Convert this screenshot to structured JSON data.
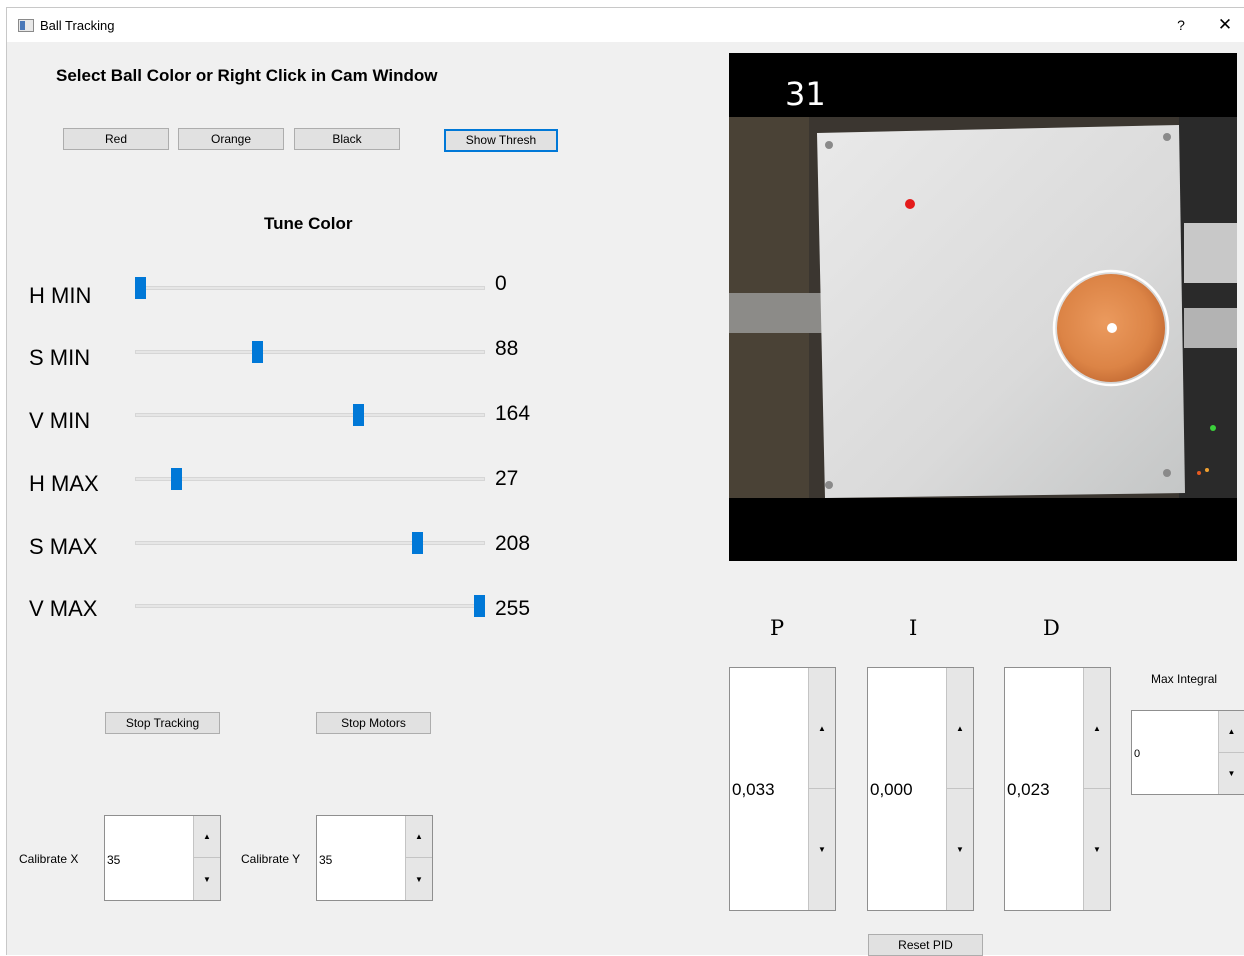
{
  "window": {
    "title": "Ball Tracking",
    "help_label": "?",
    "close_label": "✕"
  },
  "select": {
    "heading": "Select Ball Color or Right Click in Cam Window",
    "buttons": [
      {
        "label": "Red"
      },
      {
        "label": "Orange"
      },
      {
        "label": "Black"
      }
    ],
    "show_thresh_label": "Show Thresh"
  },
  "tune": {
    "heading": "Tune Color",
    "sliders": [
      {
        "label": "H MIN",
        "value": "0",
        "fraction": 0.0
      },
      {
        "label": "S MIN",
        "value": "88",
        "fraction": 0.345
      },
      {
        "label": "V MIN",
        "value": "164",
        "fraction": 0.643
      },
      {
        "label": "H MAX",
        "value": "27",
        "fraction": 0.106
      },
      {
        "label": "S MAX",
        "value": "208",
        "fraction": 0.816
      },
      {
        "label": "V MAX",
        "value": "255",
        "fraction": 1.0
      }
    ]
  },
  "controls": {
    "stop_tracking_label": "Stop Tracking",
    "stop_motors_label": "Stop Motors",
    "calibrate_x_label": "Calibrate X",
    "calibrate_x_value": "35",
    "calibrate_y_label": "Calibrate Y",
    "calibrate_y_value": "35"
  },
  "camera": {
    "fps": "31",
    "colors": {
      "ball": "#e08a4c",
      "marker": "#e41b1b",
      "ring": "#ffffff"
    }
  },
  "pid": {
    "p_label": "P",
    "p_value": "0,033",
    "i_label": "I",
    "i_value": "0,000",
    "d_label": "D",
    "d_value": "0,023",
    "max_integral_label": "Max Integral",
    "max_integral_value": "0",
    "reset_label": "Reset PID"
  },
  "colors": {
    "accent": "#0078d7",
    "button_bg": "#e1e1e1",
    "window_bg": "#f0f0f0"
  }
}
